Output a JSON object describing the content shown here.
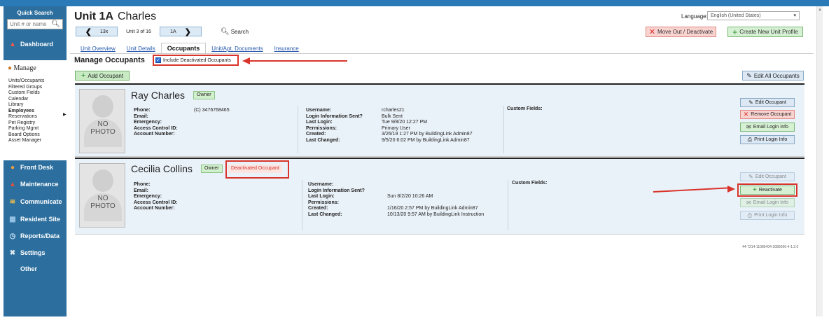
{
  "sidebar": {
    "quick_search_title": "Quick Search",
    "quick_search_placeholder": "Unit # or name",
    "dashboard": "Dashboard",
    "manage_heading": "Manage",
    "manage_items": [
      "Units/Occupants",
      "Filtered Groups",
      "Custom Fields",
      "Calendar",
      "Library",
      "Employees",
      "Reservations",
      "Pet Registry",
      "Parking Mgmt",
      "Board Options",
      "Asset Manager"
    ],
    "nav": [
      "Front Desk",
      "Maintenance",
      "Communicate",
      "Resident Site",
      "Reports/Data",
      "Settings",
      "Other"
    ]
  },
  "header": {
    "unit_label": "Unit 1A",
    "unit_name": "Charles",
    "language_label": "Language:",
    "language_value": "English (United States)",
    "prev_unit": "13x",
    "unit_position": "Unit 3 of 16",
    "next_unit": "1A",
    "search_label": "Search",
    "move_out_label": "Move Out / Deactivate",
    "create_profile_label": "Create New Unit Profile"
  },
  "tabs": [
    "Unit Overview",
    "Unit Details",
    "Occupants",
    "Unit/Apt. Documents",
    "Insurance"
  ],
  "active_tab_index": 2,
  "occupants_panel": {
    "title": "Manage Occupants",
    "include_deactivated_label": "Include Deactivated Occupants",
    "include_deactivated_checked": true,
    "add_label": "Add Occupant",
    "edit_all_label": "Edit All Occupants",
    "photo_placeholder_line1": "NO",
    "photo_placeholder_line2": "PHOTO",
    "field_labels": {
      "phone": "Phone:",
      "email": "Email:",
      "emergency": "Emergency:",
      "access": "Access Control ID:",
      "account": "Account Number:",
      "username": "Username:",
      "login_sent": "Login Information Sent?",
      "last_login": "Last Login:",
      "permissions": "Permissions:",
      "created": "Created:",
      "last_changed": "Last Changed:",
      "custom": "Custom Fields:"
    },
    "occupants": [
      {
        "name": "Ray Charles",
        "badge": "Owner",
        "phone": "(C) 3476768465",
        "username": "rcharles21",
        "login_sent": "Bulk Sent",
        "last_login": "Tue 9/8/20 12:27 PM",
        "permissions": "Primary User",
        "created": "3/26/19 1:27 PM by BuildingLink Admin87",
        "last_changed": "9/5/20 6:02 PM by BuildingLink Admin87",
        "buttons": [
          "Edit Occupant",
          "Remove Occupant",
          "Email Login Info",
          "Print Login Info"
        ]
      },
      {
        "name": "Cecilia Collins",
        "badge": "Owner",
        "status_badge": "Deactivated Occupant",
        "last_login": "Sun 8/2/20 10:26 AM",
        "created": "1/16/20 2:57 PM by BuildingLink Admin87",
        "last_changed": "10/13/20 9:57 AM by BuildingLink Instruction",
        "buttons": [
          "Edit Occupant",
          "Reactivate",
          "Email Login Info",
          "Print Login Info"
        ]
      }
    ]
  },
  "version": "44-7214-11085404-3085066-4-1.2.0",
  "colors": {
    "sidebar": "#2c6f9e",
    "highlight_red": "#d9342b",
    "panel_bg": "#eaf2f9"
  }
}
